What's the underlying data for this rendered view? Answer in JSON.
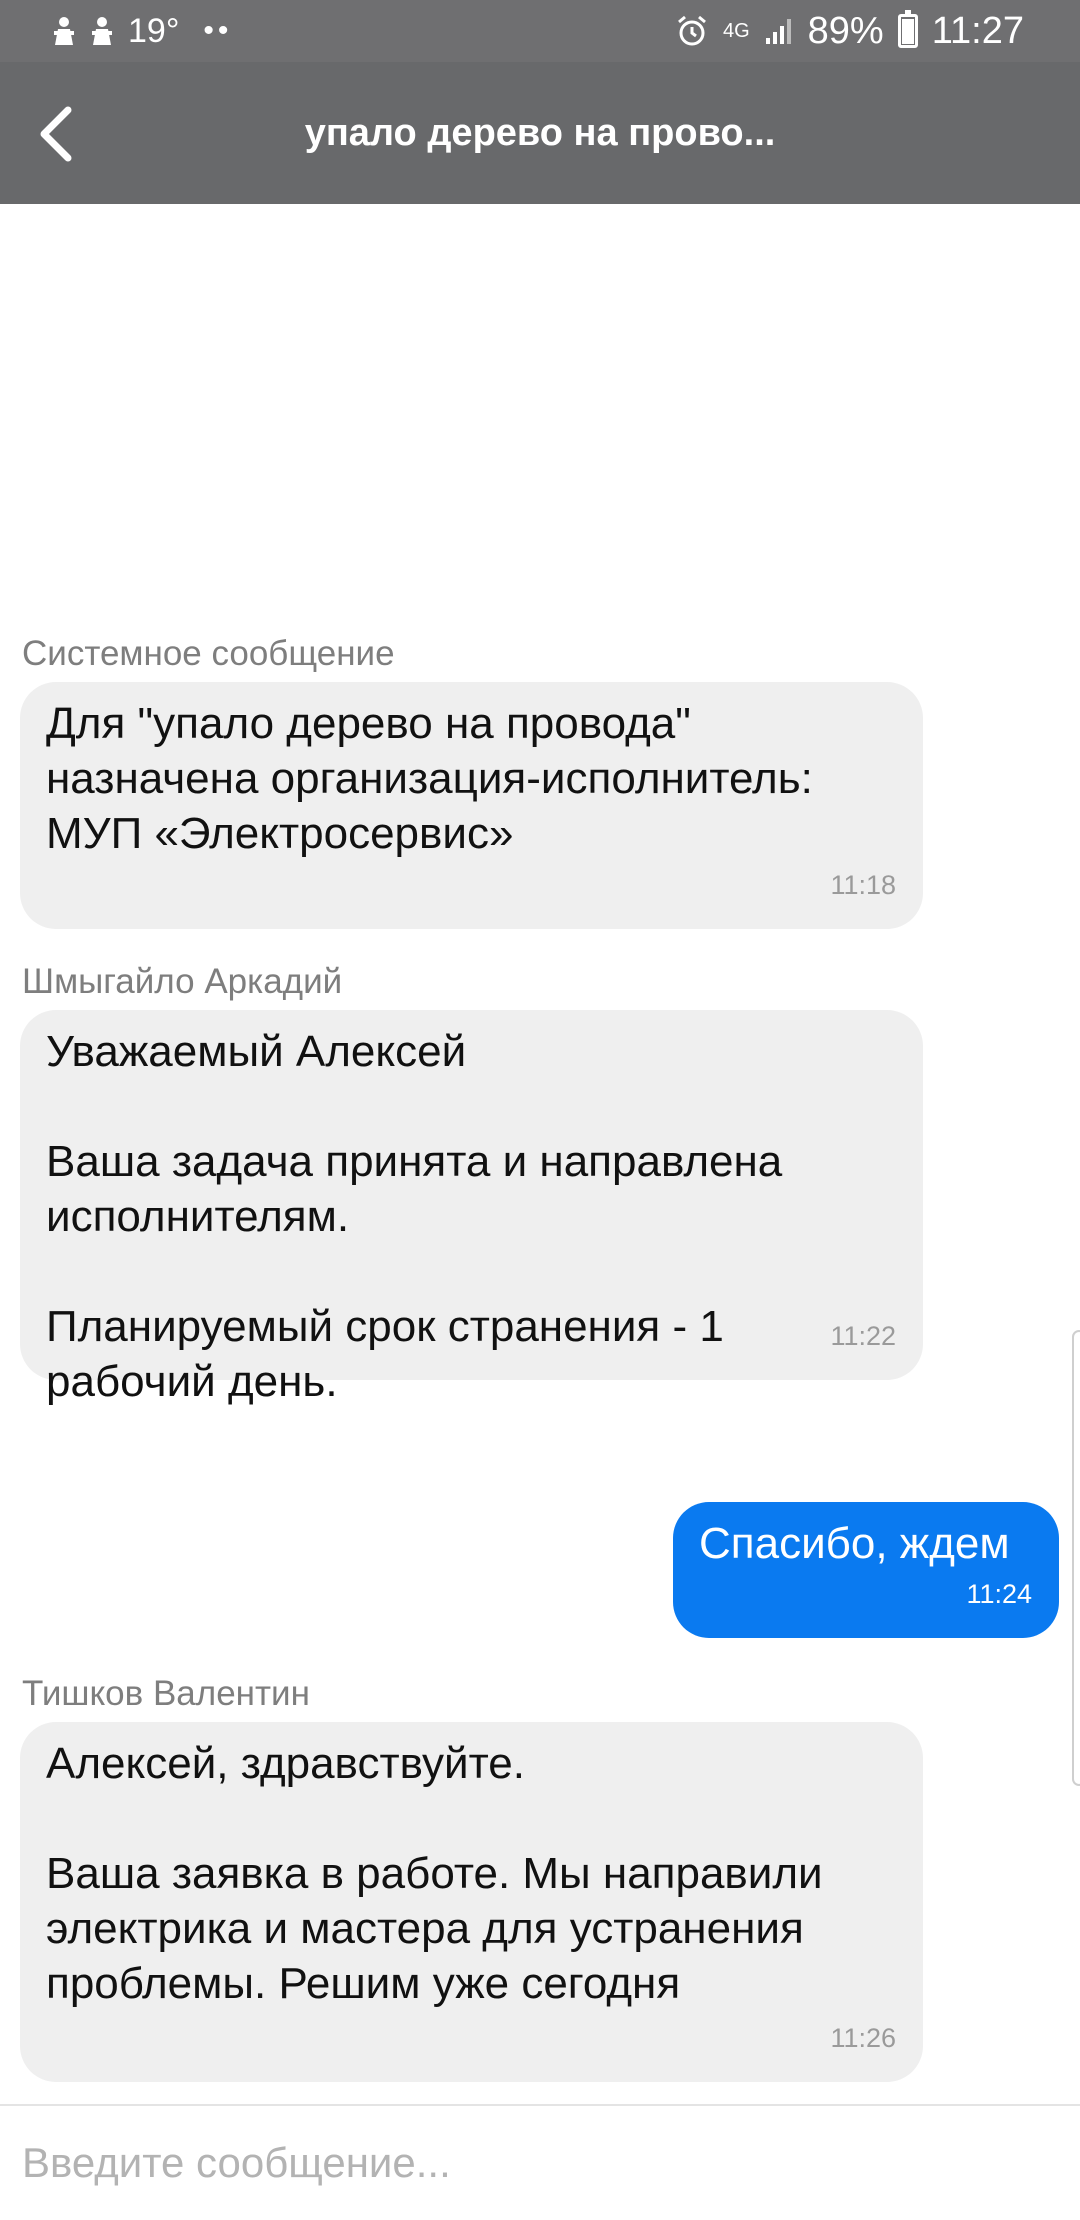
{
  "status_bar": {
    "temperature": "19°",
    "signal_type": "4G",
    "battery": "89%",
    "battery_level": 0.89,
    "time": "11:27",
    "icons": [
      "notification-icon",
      "notification-icon",
      "weather",
      "alarm-icon",
      "signal-icon",
      "battery-icon"
    ]
  },
  "toolbar": {
    "title": "упало дерево на прово..."
  },
  "messages": [
    {
      "sender": "Системное сообщение",
      "text": "Для \"упало дерево на провода\"\nназначена организация-исполнитель:\nМУП «Электросервис»",
      "time": "11:18",
      "direction": "incoming"
    },
    {
      "sender": "Шмыгайло Аркадий",
      "text": "Уважаемый Алексей\n\nВаша задача принята и направлена\nисполнителям.\n\nПланируемый срок странения - 1\nрабочий день.",
      "time": "11:22",
      "direction": "incoming"
    },
    {
      "sender": "",
      "text": "Спасибо, ждем",
      "time": "11:24",
      "direction": "outgoing"
    },
    {
      "sender": "Тишков Валентин",
      "text": "Алексей, здравствуйте.\n\nВаша заявка в работе. Мы направили\nэлектрика и мастера для устранения\nпроблемы. Решим уже сегодня",
      "time": "11:26",
      "direction": "incoming"
    }
  ],
  "input": {
    "value": "",
    "placeholder": "Введите сообщение..."
  },
  "colors": {
    "status_bar": "#6f6f71",
    "toolbar": "#68696b",
    "incoming_bubble": "#efefef",
    "outgoing_bubble": "#0a7af0"
  }
}
